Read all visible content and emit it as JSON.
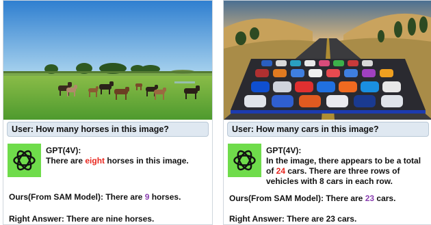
{
  "left": {
    "question": "User: How many horses in this image?",
    "model": "GPT(4V):",
    "gpt_pre": "There are ",
    "gpt_count": "eight",
    "gpt_post": " horses in this image.",
    "ours_pre": "Ours(From SAM Model): There are ",
    "ours_count": "9",
    "ours_post": " horses.",
    "answer": "Right Answer: There are nine horses."
  },
  "right": {
    "question": "User: How many cars in this image?",
    "model": "GPT(4V):",
    "gpt_pre": "In the image, there appears to be a total of ",
    "gpt_count": "24",
    "gpt_post": " cars. There are three rows of vehicles with 8 cars in each row.",
    "ours_pre": "Ours(From SAM Model): There are ",
    "ours_count": "23",
    "ours_post": " cars.",
    "answer": "Right Answer: There are 23 cars."
  },
  "colors": {
    "gpt_wrong": "#e8261e",
    "ours_count": "#8a3fb0",
    "logo_bg": "#6fdc4b",
    "question_bg": "#dfe8f1"
  },
  "icons": {
    "gpt": "openai-logo-icon"
  }
}
